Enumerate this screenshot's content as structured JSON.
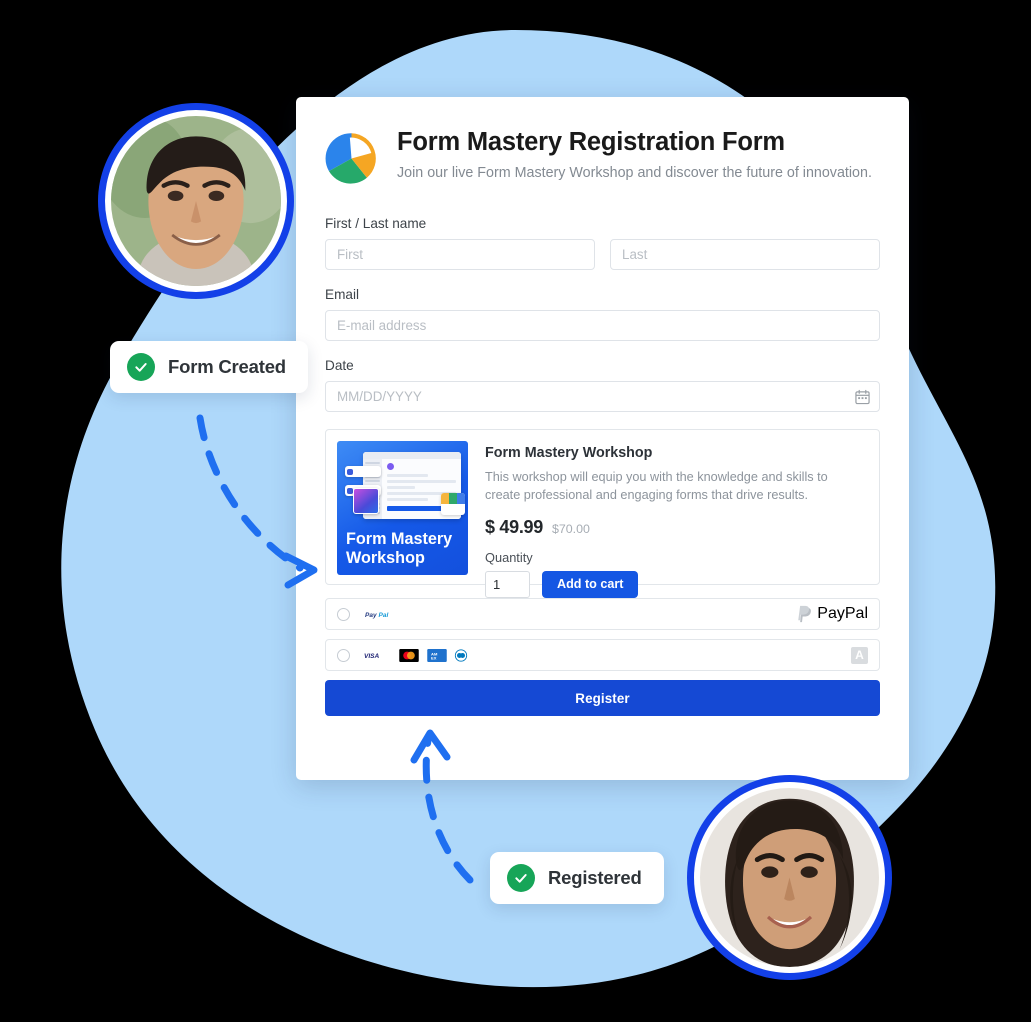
{
  "theme": {
    "blob_color": "#aed8fa",
    "accent_blue": "#1557e3",
    "register_blue": "#1549d4",
    "ring_blue": "#1340e8",
    "success_green": "#17a558",
    "arrow_blue": "#1f6ff0",
    "canvas_bg": "#000000"
  },
  "form": {
    "title": "Form Mastery Registration Form",
    "subtitle": "Join our live Form Mastery Workshop and discover the future of innovation.",
    "logo_name": "pinwheel-logo",
    "fields": {
      "name_label": "First / Last name",
      "first_placeholder": "First",
      "first_value": "",
      "last_placeholder": "Last",
      "last_value": "",
      "email_label": "Email",
      "email_placeholder": "E-mail address",
      "email_value": "",
      "date_label": "Date",
      "date_placeholder": "MM/DD/YYYY",
      "date_value": "",
      "calendar_icon": "calendar-icon"
    },
    "product": {
      "thumb_caption": "Form Mastery Workshop",
      "name": "Form Mastery Workshop",
      "description": "This workshop will equip you with the knowledge and skills to create professional and engaging forms that drive results.",
      "price": "$ 49.99",
      "price_old": "$70.00",
      "quantity_label": "Quantity",
      "quantity_value": "1",
      "add_to_cart_label": "Add to cart"
    },
    "payment": {
      "options": [
        {
          "id": "paypal",
          "selected": false,
          "mark_label": "PayPal",
          "right_label": "PayPal",
          "right_icon": "paypal-logo-icon"
        },
        {
          "id": "credit-card",
          "selected": false,
          "cards": [
            "VISA",
            "Mastercard",
            "AMEX",
            "Diners Club"
          ],
          "right_icon": "amex-a-icon",
          "right_label": "A"
        }
      ]
    },
    "submit_label": "Register"
  },
  "badges": [
    {
      "id": "form-created",
      "label": "Form Created",
      "icon": "check-circle-icon"
    },
    {
      "id": "registered",
      "label": "Registered",
      "icon": "check-circle-icon"
    }
  ],
  "avatars": [
    {
      "id": "avatar-top",
      "alt": "smiling-man-portrait"
    },
    {
      "id": "avatar-bottom",
      "alt": "smiling-woman-portrait"
    }
  ],
  "arrows": [
    {
      "id": "arrow-to-product",
      "style": "dashed-curved-arrow"
    },
    {
      "id": "arrow-to-register",
      "style": "dashed-curved-arrow"
    }
  ]
}
